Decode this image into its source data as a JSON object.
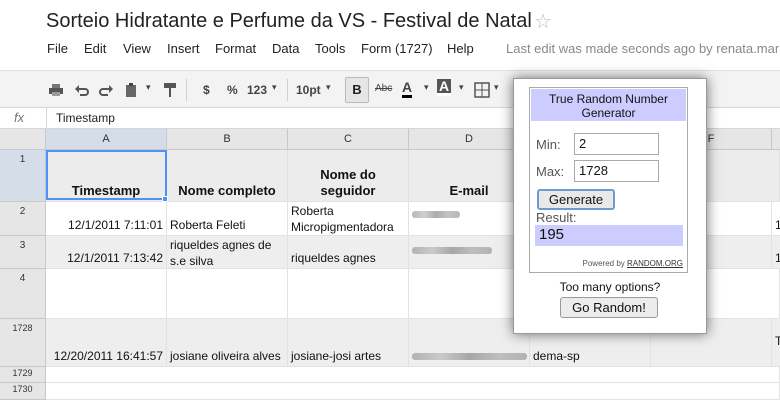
{
  "title": "Sorteio Hidratante e Perfume da VS - Festival de Natal",
  "menu": [
    "File",
    "Edit",
    "View",
    "Insert",
    "Format",
    "Data",
    "Tools",
    "Form (1727)",
    "Help"
  ],
  "last_edit": "Last edit was made seconds ago by renata.mar",
  "toolbar": {
    "currency": "$",
    "percent": "%",
    "number_format": "123",
    "font_size": "10pt",
    "bold": "B",
    "strike": "Abc",
    "text_color": "A",
    "fill_color": "A"
  },
  "formula": {
    "fx": "fx",
    "value": "Timestamp"
  },
  "columns": [
    "A",
    "B",
    "C",
    "D",
    "F"
  ],
  "rows": {
    "r1": "1",
    "r2": "2",
    "r3": "3",
    "r4": "4",
    "r1728": "1728",
    "r1729": "1729",
    "r1730": "1730"
  },
  "headers": {
    "a": "Timestamp",
    "b": "Nome completo",
    "c": "Nome do seguidor",
    "d": "E-mail"
  },
  "data": {
    "r2": {
      "a": "12/1/2011 7:11:01",
      "b": "Roberta Feleti",
      "c": "Roberta Micropigmentadora",
      "right": "1"
    },
    "r3": {
      "a": "12/1/2011 7:13:42",
      "b": "riqueldes agnes de s.e silva",
      "c": "riqueldes agnes",
      "right": "1"
    },
    "r1728": {
      "a": "12/20/2011 16:41:57",
      "b": "josiane oliveira alves",
      "c": "josiane-josi artes",
      "e": "dema-sp",
      "right": "T"
    }
  },
  "widget": {
    "title": "True Random Number Generator",
    "min_label": "Min:",
    "min_value": "2",
    "max_label": "Max:",
    "max_value": "1728",
    "generate_label": "Generate",
    "result_label": "Result:",
    "result_value": "195",
    "powered_prefix": "Powered by",
    "powered_link": "RANDOM.ORG",
    "too_many": "Too many options?",
    "go_random": "Go Random!"
  },
  "colors": {
    "widget_header": "#ccccff",
    "selection": "#4d90fe"
  }
}
